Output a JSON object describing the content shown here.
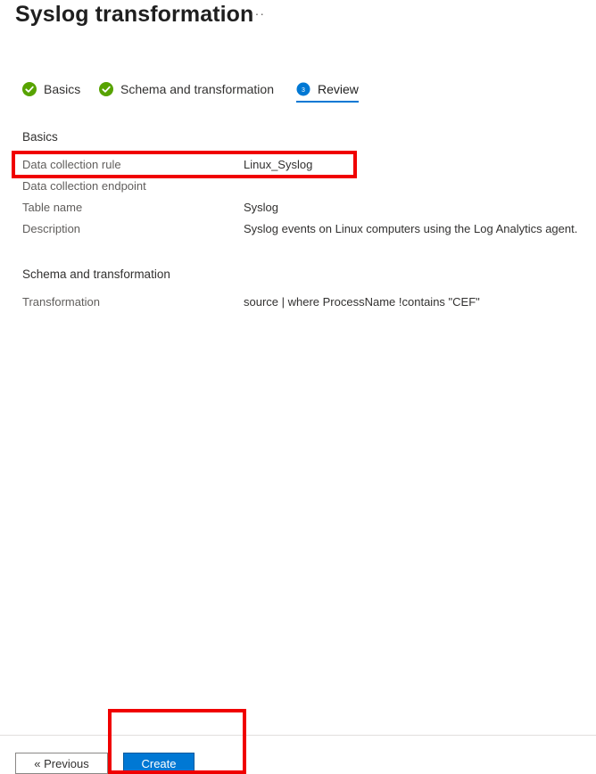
{
  "header": {
    "title": "Syslog transformation",
    "more_label": "···"
  },
  "steps": [
    {
      "label": "Basics",
      "state": "done",
      "icon": "checkmark-circle-icon"
    },
    {
      "label": "Schema and transformation",
      "state": "done",
      "icon": "checkmark-circle-icon"
    },
    {
      "label": "Review",
      "state": "active",
      "number": "3",
      "icon": "step-number-icon"
    }
  ],
  "review": {
    "basics": {
      "section_title": "Basics",
      "rows": [
        {
          "label": "Data collection rule",
          "value": "Linux_Syslog"
        },
        {
          "label": "Data collection endpoint",
          "value": ""
        },
        {
          "label": "Table name",
          "value": "Syslog"
        },
        {
          "label": "Description",
          "value": "Syslog events on Linux computers using the Log Analytics agent."
        }
      ]
    },
    "schema": {
      "section_title": "Schema and transformation",
      "rows": [
        {
          "label": "Transformation",
          "value": "source | where ProcessName !contains \"CEF\""
        }
      ]
    }
  },
  "footer": {
    "previous_label": "« Previous",
    "create_label": "Create"
  },
  "colors": {
    "accent": "#0078d4",
    "success": "#57a300",
    "highlight": "#f00000"
  }
}
